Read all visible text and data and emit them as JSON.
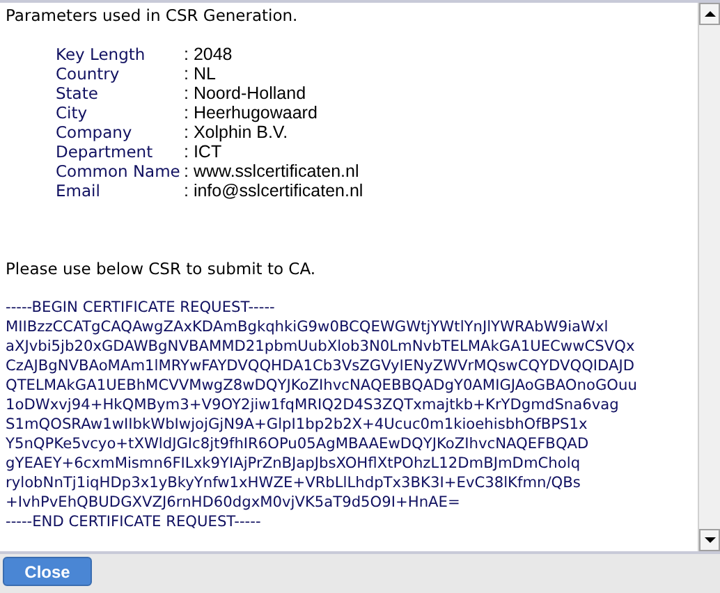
{
  "heading": "Parameters used in CSR Generation.",
  "parameters": [
    {
      "label": "Key Length",
      "value": ": 2048"
    },
    {
      "label": "Country",
      "value": ": NL"
    },
    {
      "label": "State",
      "value": ": Noord-Holland"
    },
    {
      "label": "City",
      "value": ": Heerhugowaard"
    },
    {
      "label": "Company",
      "value": ": Xolphin B.V."
    },
    {
      "label": "Department",
      "value": ": ICT"
    },
    {
      "label": "Common Name",
      "value": ": www.sslcertificaten.nl"
    },
    {
      "label": "Email",
      "value": ": info@sslcertificaten.nl"
    }
  ],
  "instruction": "Please use below CSR to submit to CA.",
  "csr_lines": [
    "-----BEGIN CERTIFICATE REQUEST-----",
    "MIIBzzCCATgCAQAwgZAxKDAmBgkqhkiG9w0BCQEWGWtjYWtlYnJlYWRAbW9iaWxl",
    "aXJvbi5jb20xGDAWBgNVBAMMD21pbmUubXlob3N0LmNvbTELMAkGA1UECwwCSVQx",
    "CzAJBgNVBAoMAm1lMRYwFAYDVQQHDA1Cb3VsZGVyIENyZWVrMQswCQYDVQQIDAJD",
    "QTELMAkGA1UEBhMCVVMwgZ8wDQYJKoZIhvcNAQEBBQADgY0AMIGJAoGBAOnoGOuu",
    "1oDWxvj94+HkQMBym3+V9OY2jiw1fqMRIQ2D4S3ZQTxmajtkb+KrYDgmdSna6vag",
    "S1mQOSRAw1wIIbkWbIwjojGjN9A+GlpI1bp2b2X+4Ucuc0m1kioehisbhOfBPS1x",
    "Y5nQPKe5vcyo+tXWldJGIc8jt9fhIR6OPu05AgMBAAEwDQYJKoZIhvcNAQEFBQAD",
    "gYEAEY+6cxmMismn6FILxk9YIAjPrZnBJapJbsXOHflXtPOhzL12DmBJmDmCholq",
    "rylobNnTj1iqHDp3x1yBkyYnfw1xHWZE+VRbLlLhdpTx3BK3I+EvC38lKfmn/QBs",
    "+IvhPvEhQBUDGXVZJ6rnHD60dgxM0vjVK5aT9d5O9I+HnAE=",
    "-----END CERTIFICATE REQUEST-----"
  ],
  "buttons": [
    "Close"
  ]
}
